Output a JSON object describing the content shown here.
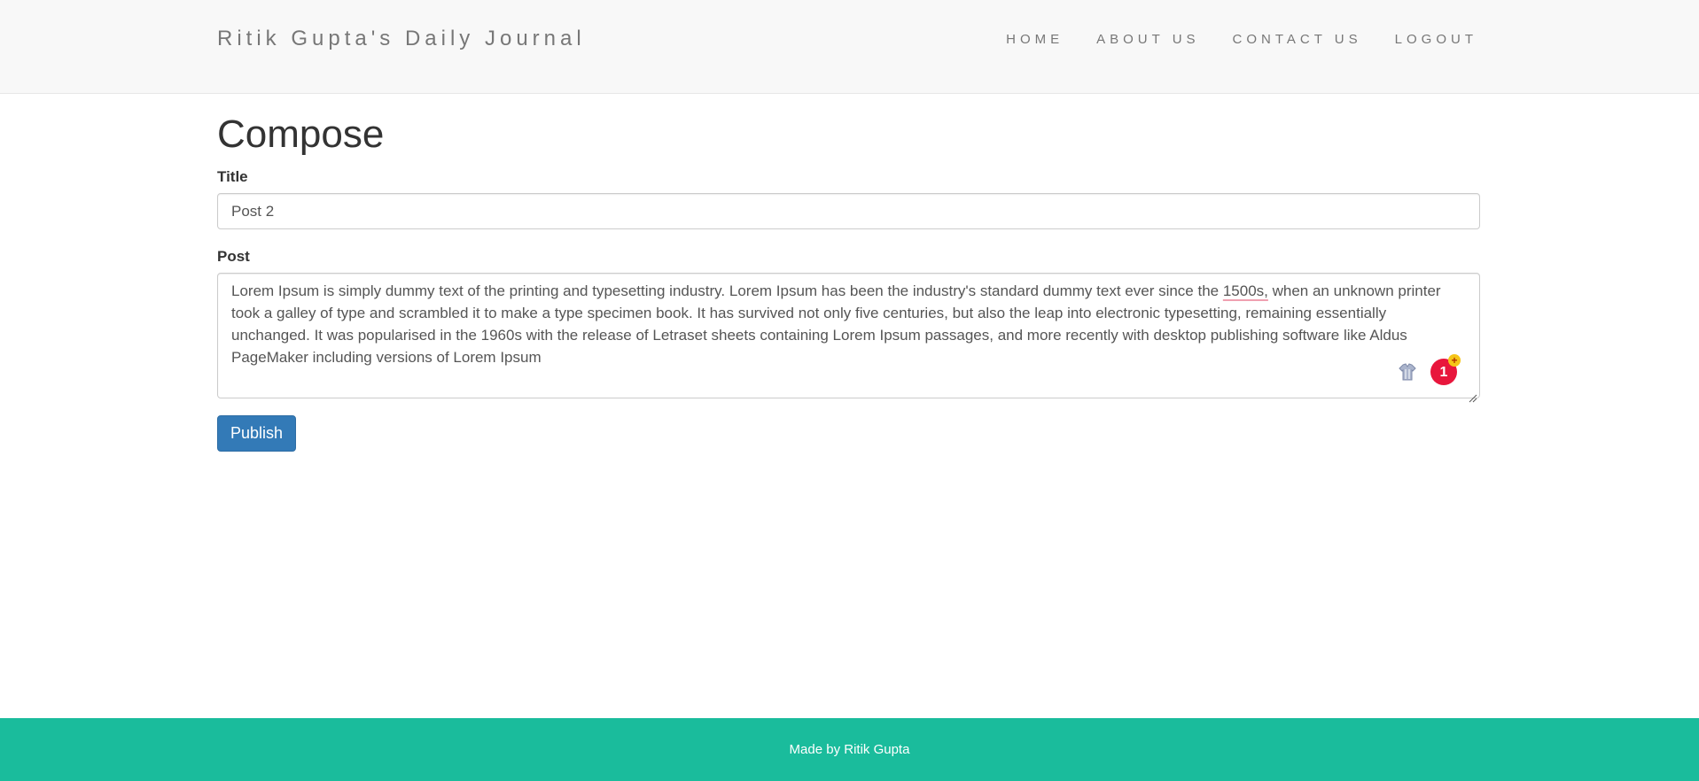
{
  "navbar": {
    "brand": "Ritik Gupta's Daily Journal",
    "links": [
      "HOME",
      "ABOUT US",
      "CONTACT US",
      "LOGOUT"
    ]
  },
  "main": {
    "heading": "Compose",
    "title_label": "Title",
    "title_value": "Post 2",
    "post_label": "Post",
    "post_before": "Lorem Ipsum is simply dummy text of the printing and typesetting industry. Lorem Ipsum has been the industry's standard dummy text ever since the ",
    "post_spell": "1500s,",
    "post_after": " when an unknown printer took a galley of type and scrambled it to make a type specimen book. It has survived not only five centuries, but also the leap into electronic typesetting, remaining essentially unchanged. It was popularised in the 1960s with the release of Letraset sheets containing Lorem Ipsum passages, and more recently with desktop publishing software like Aldus PageMaker including versions of Lorem Ipsum",
    "extension_badge": "1",
    "extension_plus": "+",
    "publish_label": "Publish"
  },
  "footer": {
    "text": "Made by Ritik Gupta"
  },
  "colors": {
    "navbar_bg": "#f8f8f8",
    "primary_button": "#337ab7",
    "footer_bg": "#1abc9c",
    "badge": "#e8163c"
  },
  "icons": [
    "extension-shirt-icon",
    "resize-grip-icon"
  ]
}
